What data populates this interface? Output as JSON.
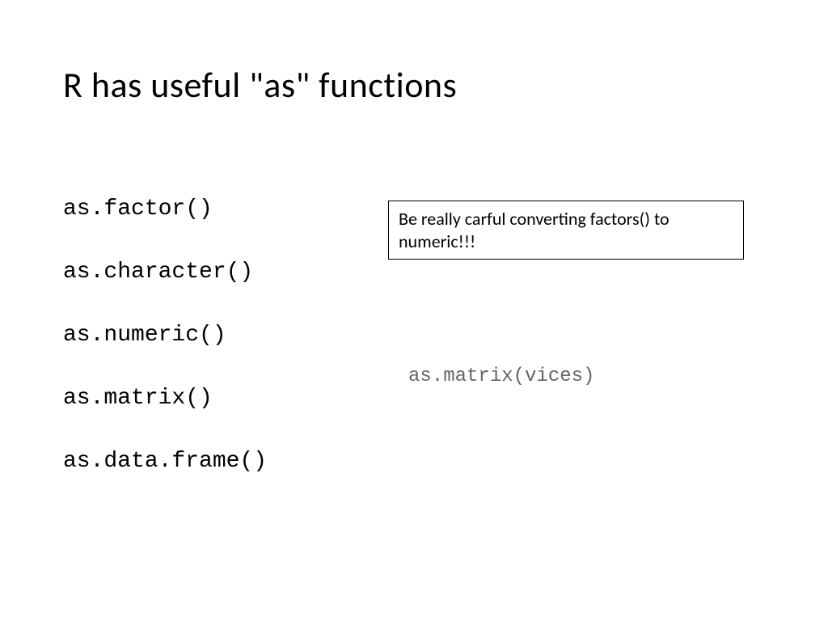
{
  "title": "R has useful \"as\" functions",
  "functions": [
    "as.factor()",
    "as.character()",
    "as.numeric()",
    "as.matrix()",
    "as.data.frame()"
  ],
  "callout": "Be really carful converting factors() to numeric!!!",
  "example": "as.matrix(vices)"
}
